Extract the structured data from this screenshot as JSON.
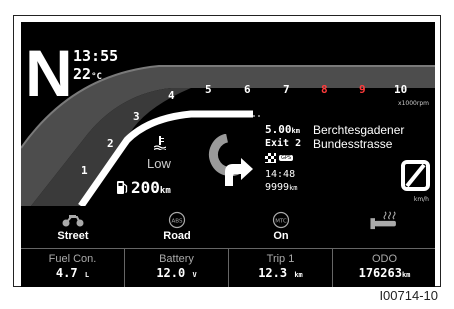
{
  "gear": "N",
  "time": "13:55",
  "temperature": {
    "value": "22",
    "unit": "°C"
  },
  "tach": {
    "labels": [
      "1",
      "2",
      "3",
      "4",
      "5",
      "6",
      "7",
      "8",
      "9",
      "10"
    ],
    "unit": "x1000rpm"
  },
  "coolant": {
    "icon": "coolant-temperature-icon",
    "status": "Low"
  },
  "fuel_range": {
    "icon": "fuel-pump-icon",
    "value": "200",
    "unit": "km"
  },
  "navigation": {
    "distance": "5.00",
    "distance_unit": "km",
    "exit": "Exit 2",
    "street_line1": "Berchtesgadener",
    "street_line2": "Bundesstrasse",
    "gps_badge": "GPS",
    "arrival_time": "14:48",
    "remaining": "9999",
    "remaining_unit": "km"
  },
  "speed": {
    "status": "no-signal",
    "unit": "km/h"
  },
  "modes": [
    {
      "icon": "motorcycle-icon",
      "label": "Street"
    },
    {
      "icon": "abs-icon",
      "icon_text": "ABS",
      "label": "Road"
    },
    {
      "icon": "mtc-icon",
      "icon_text": "MTC",
      "label": "On"
    },
    {
      "icon": "heated-grip-icon",
      "label": ""
    }
  ],
  "info": [
    {
      "label": "Fuel Con.",
      "value": "4.7",
      "unit": "L"
    },
    {
      "label": "Battery",
      "value": "12.0",
      "unit": "V"
    },
    {
      "label": "Trip 1",
      "value": "12.3",
      "unit": "km"
    },
    {
      "label": "ODO",
      "value": "176263",
      "unit": "km"
    }
  ],
  "caption": "I00714-10",
  "colors": {
    "background": "#000000",
    "text": "#ffffff",
    "redline": "#ff3b3b",
    "arc": "#ffffff"
  }
}
